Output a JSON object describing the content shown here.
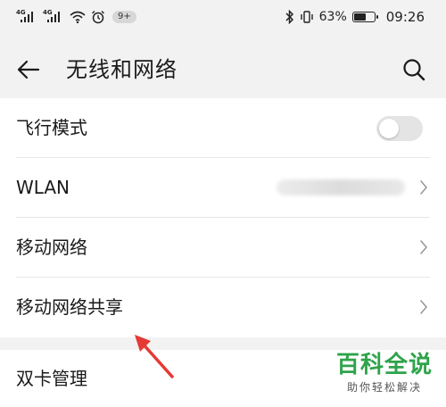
{
  "status_bar": {
    "signal1_tag": "4G",
    "signal2_tag": "4G",
    "notification_badge": "9+",
    "battery_percent": "63%",
    "battery_level": 0.63,
    "time": "09:26",
    "icons": [
      "signal-icon",
      "signal-icon",
      "wifi-icon",
      "alarm-icon",
      "bluetooth-icon",
      "vibrate-icon",
      "battery-icon"
    ]
  },
  "header": {
    "title": "无线和网络",
    "back_icon": "back-arrow-icon",
    "search_icon": "search-icon"
  },
  "settings": {
    "items": [
      {
        "label": "飞行模式",
        "control": "toggle",
        "toggle_on": false
      },
      {
        "label": "WLAN",
        "control": "chevron"
      },
      {
        "label": "移动网络",
        "control": "chevron"
      },
      {
        "label": "移动网络共享",
        "control": "chevron"
      }
    ]
  },
  "settings2": {
    "items": [
      {
        "label": "双卡管理"
      }
    ]
  },
  "watermark": {
    "title": "百科全说",
    "subtitle": "助你轻松解决"
  },
  "colors": {
    "background": "#f2f2f2",
    "card": "#ffffff",
    "annotation_arrow": "#e53935",
    "watermark_green": "#2fa34b"
  }
}
